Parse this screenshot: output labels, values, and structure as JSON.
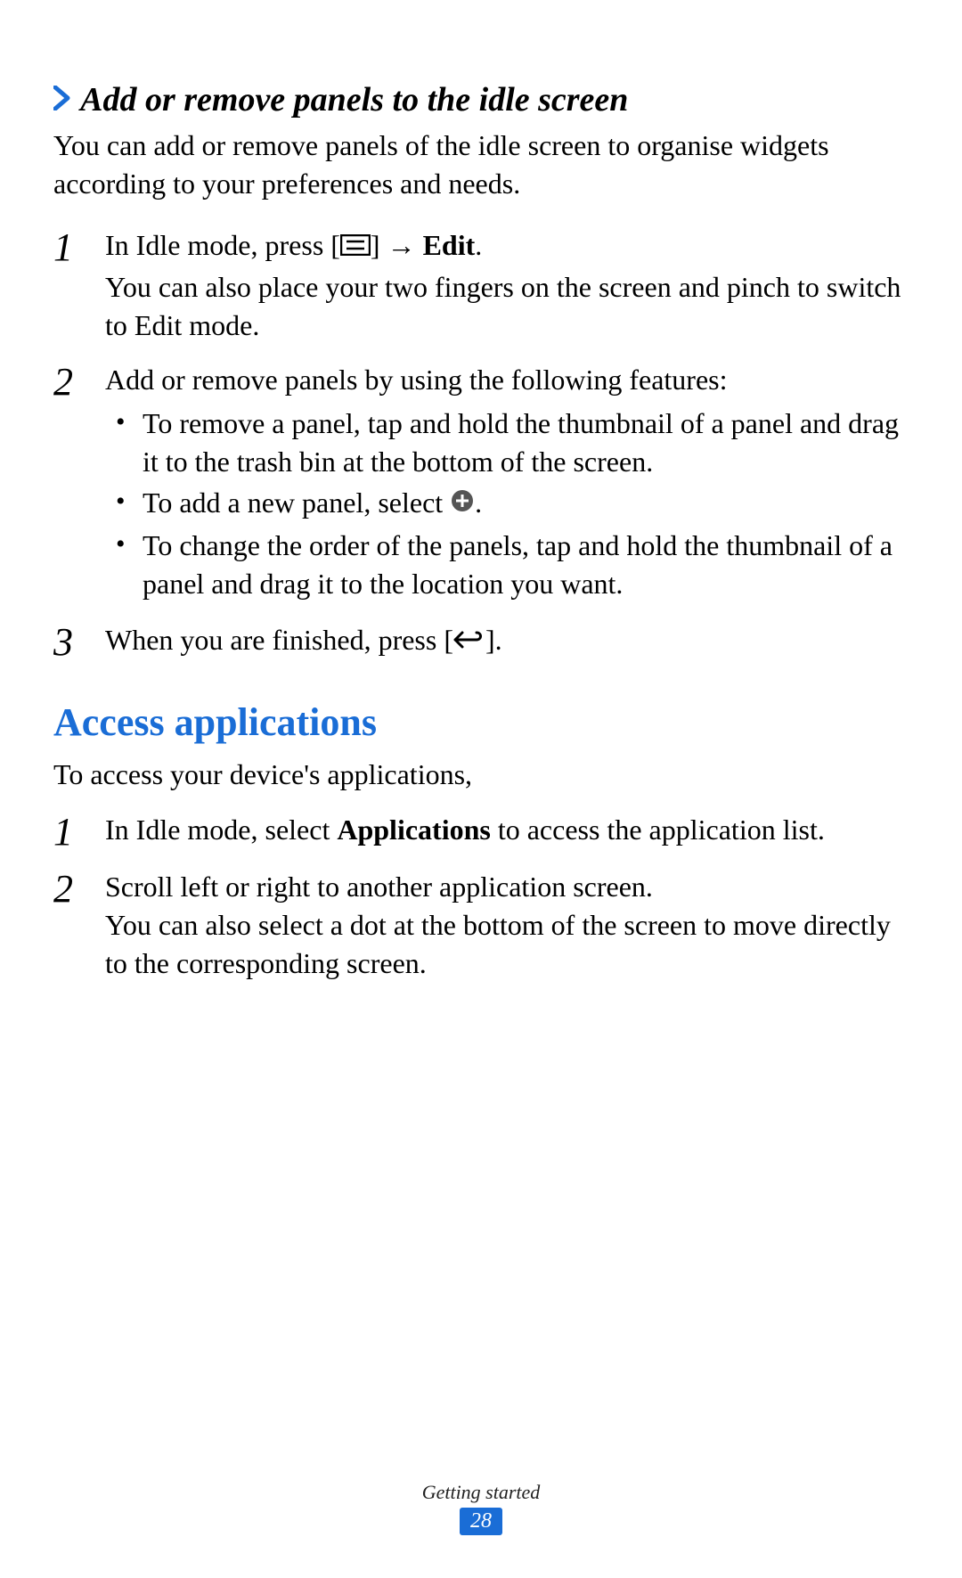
{
  "section1": {
    "heading": "Add or remove panels to the idle screen",
    "intro": "You can add or remove panels of the idle screen to organise widgets according to your preferences and needs.",
    "step1": {
      "line1_pre": "In Idle mode, press [",
      "line1_post": "] → ",
      "line1_bold": "Edit",
      "line1_end": ".",
      "line2": "You can also place your two fingers on the screen and pinch to switch to Edit mode."
    },
    "step2": {
      "intro": "Add or remove panels by using the following features:",
      "b1": "To remove a panel, tap and hold the thumbnail of a panel and drag it to the trash bin at the bottom of the screen.",
      "b2_pre": "To add a new panel, select ",
      "b2_post": ".",
      "b3": "To change the order of the panels, tap and hold the thumbnail of a panel and drag it to the location you want."
    },
    "step3": {
      "pre": "When you are finished, press [",
      "post": "]."
    }
  },
  "section2": {
    "heading": "Access applications",
    "intro": "To access your device's applications,",
    "step1_pre": "In Idle mode, select ",
    "step1_bold": "Applications",
    "step1_post": " to access the application list.",
    "step2_line1": "Scroll left or right to another application screen.",
    "step2_line2": "You can also select a dot at the bottom of the screen to move directly to the corresponding screen."
  },
  "nums": {
    "n1": "1",
    "n2": "2",
    "n3": "3"
  },
  "footer": {
    "label": "Getting started",
    "page": "28"
  }
}
